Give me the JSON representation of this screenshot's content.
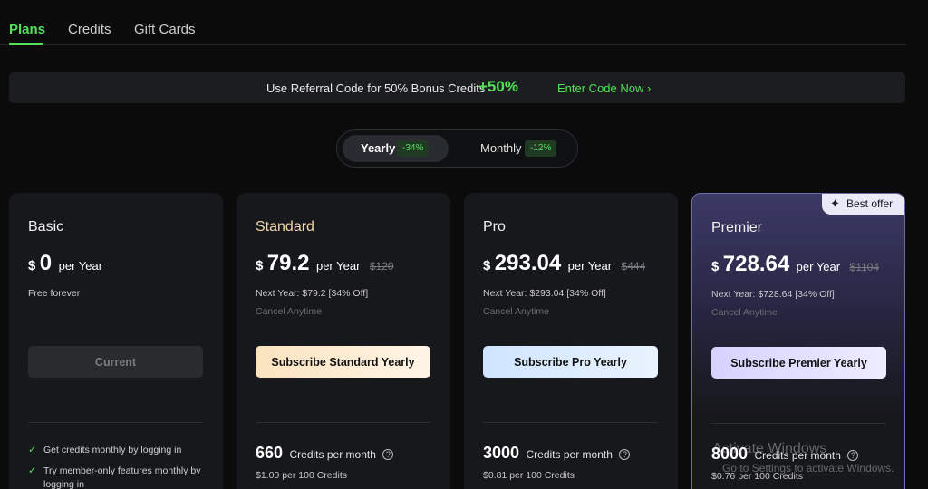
{
  "tabs": [
    {
      "label": "Plans"
    },
    {
      "label": "Credits"
    },
    {
      "label": "Gift Cards"
    }
  ],
  "banner": {
    "text": "Use Referral Code for 50% Bonus Credits",
    "bonus": "+50%",
    "link": "Enter Code Now"
  },
  "billing": {
    "yearly_label": "Yearly",
    "yearly_discount": "-34%",
    "monthly_label": "Monthly",
    "monthly_discount": "-12%"
  },
  "plans": [
    {
      "name": "Basic",
      "currency": "$",
      "price": "0",
      "period": "per Year",
      "note": "Free forever",
      "button": "Current",
      "features": [
        "Get credits monthly by logging in",
        "Try member-only features monthly by logging in"
      ]
    },
    {
      "name": "Standard",
      "currency": "$",
      "price": "79.2",
      "period": "per Year",
      "old_price": "$120",
      "next_year": "Next Year: $79.2 [34% Off]",
      "cancel": "Cancel Anytime",
      "button": "Subscribe Standard Yearly",
      "credits": "660",
      "credits_label": "Credits per month",
      "credits_rate": "$1.00 per 100 Credits"
    },
    {
      "name": "Pro",
      "currency": "$",
      "price": "293.04",
      "period": "per Year",
      "old_price": "$444",
      "next_year": "Next Year: $293.04 [34% Off]",
      "cancel": "Cancel Anytime",
      "button": "Subscribe Pro Yearly",
      "credits": "3000",
      "credits_label": "Credits per month",
      "credits_rate": "$0.81 per 100 Credits"
    },
    {
      "name": "Premier",
      "badge": "Best offer",
      "currency": "$",
      "price": "728.64",
      "period": "per Year",
      "old_price": "$1104",
      "next_year": "Next Year: $728.64 [34% Off]",
      "cancel": "Cancel Anytime",
      "button": "Subscribe Premier Yearly",
      "credits": "8000",
      "credits_label": "Credits per month",
      "credits_rate": "$0.76 per 100 Credits"
    }
  ],
  "watermark": {
    "title": "Activate Windows",
    "subtitle": "Go to Settings to activate Windows."
  },
  "colors": {
    "accent": "#56e05a",
    "background": "#0b0b0c",
    "card": "#17181b"
  }
}
